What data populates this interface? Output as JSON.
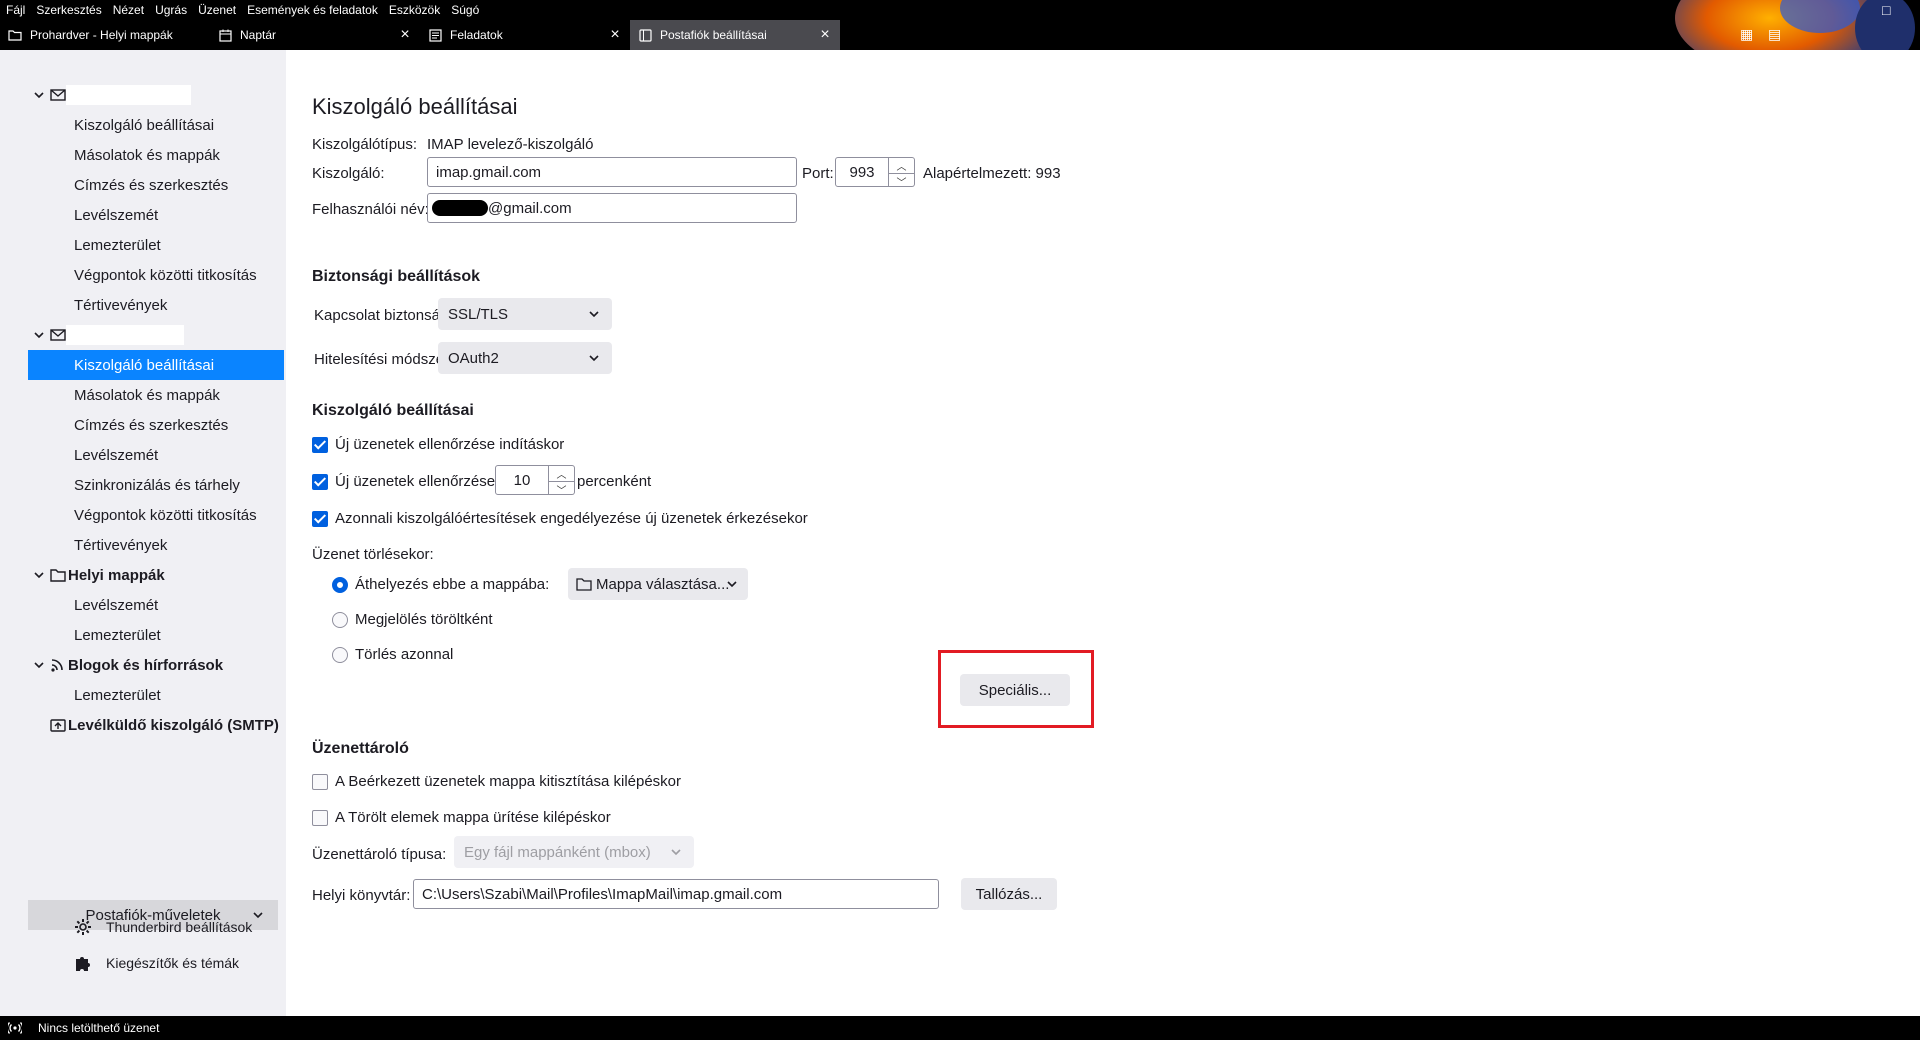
{
  "menubar": [
    "Fájl",
    "Szerkesztés",
    "Nézet",
    "Ugrás",
    "Üzenet",
    "Események és feladatok",
    "Eszközök",
    "Súgó"
  ],
  "tabs": [
    {
      "label": "Prohardver - Helyi mappák",
      "icon": "folder-icon",
      "closable": false
    },
    {
      "label": "Naptár",
      "icon": "calendar-icon",
      "closable": true
    },
    {
      "label": "Feladatok",
      "icon": "tasks-icon",
      "closable": true
    },
    {
      "label": "Postafiók beállításai",
      "icon": "settings-page-icon",
      "closable": true,
      "active": true
    }
  ],
  "sidebar": {
    "account1": {
      "items": [
        "Kiszolgáló beállításai",
        "Másolatok és mappák",
        "Címzés és szerkesztés",
        "Levélszemét",
        "Lemezterület",
        "Végpontok közötti titkosítás",
        "Tértivevények"
      ]
    },
    "account2": {
      "items": [
        "Kiszolgáló beállításai",
        "Másolatok és mappák",
        "Címzés és szerkesztés",
        "Levélszemét",
        "Szinkronizálás és tárhely",
        "Végpontok közötti titkosítás",
        "Tértivevények"
      ]
    },
    "local": {
      "title": "Helyi mappák",
      "items": [
        "Levélszemét",
        "Lemezterület"
      ]
    },
    "feeds": {
      "title": "Blogok és hírforrások",
      "items": [
        "Lemezterület"
      ]
    },
    "smtp": {
      "title": "Levélküldő kiszolgáló (SMTP)"
    },
    "account_actions": "Postafiók-műveletek",
    "bottom": [
      {
        "label": "Thunderbird beállítások",
        "icon": "gear-icon"
      },
      {
        "label": "Kiegészítők és témák",
        "icon": "puzzle-icon"
      }
    ]
  },
  "main": {
    "title": "Kiszolgáló beállításai",
    "server_type_label": "Kiszolgálótípus:",
    "server_type_value": "IMAP levelező-kiszolgáló",
    "server_label": "Kiszolgáló:",
    "server_value": "imap.gmail.com",
    "port_label": "Port:",
    "port_value": "993",
    "port_default": "Alapértelmezett: 993",
    "username_label": "Felhasználói név:",
    "username_value": "@gmail.com",
    "security": {
      "heading": "Biztonsági beállítások",
      "conn_label": "Kapcsolat biztonsága:",
      "conn_value": "SSL/TLS",
      "auth_label": "Hitelesítési módszer:",
      "auth_value": "OAuth2"
    },
    "server_settings": {
      "heading": "Kiszolgáló beállításai",
      "check_startup": "Új üzenetek ellenőrzése indításkor",
      "check_every": "Új üzenetek ellenőrzése",
      "interval_value": "10",
      "interval_unit": "percenként",
      "push": "Azonnali kiszolgálóértesítések engedélyezése új üzenetek érkezésekor",
      "on_delete_label": "Üzenet törlésekor:",
      "move_to": "Áthelyezés ebbe a mappába:",
      "folder_picker": "Mappa választása...",
      "mark_deleted": "Megjelölés töröltként",
      "delete_now": "Törlés azonnal",
      "advanced_button": "Speciális..."
    },
    "storage": {
      "heading": "Üzenettároló",
      "expunge_inbox": "A Beérkezett üzenetek mappa kitisztítása kilépéskor",
      "empty_trash": "A Törölt elemek mappa ürítése kilépéskor",
      "type_label": "Üzenettároló típusa:",
      "type_value": "Egy fájl mappánként (mbox)",
      "local_dir_label": "Helyi könyvtár:",
      "local_dir_value": "C:\\Users\\Szabi\\Mail\\Profiles\\ImapMail\\imap.gmail.com",
      "browse_button": "Tallózás..."
    }
  },
  "statusbar": {
    "text": "Nincs letölthető üzenet",
    "icon": "wifi-status-icon"
  },
  "colors": {
    "accent": "#0a84ff",
    "checkbox": "#0060df",
    "highlight": "#e21b23",
    "sidebar_bg": "#f0f0f4"
  }
}
